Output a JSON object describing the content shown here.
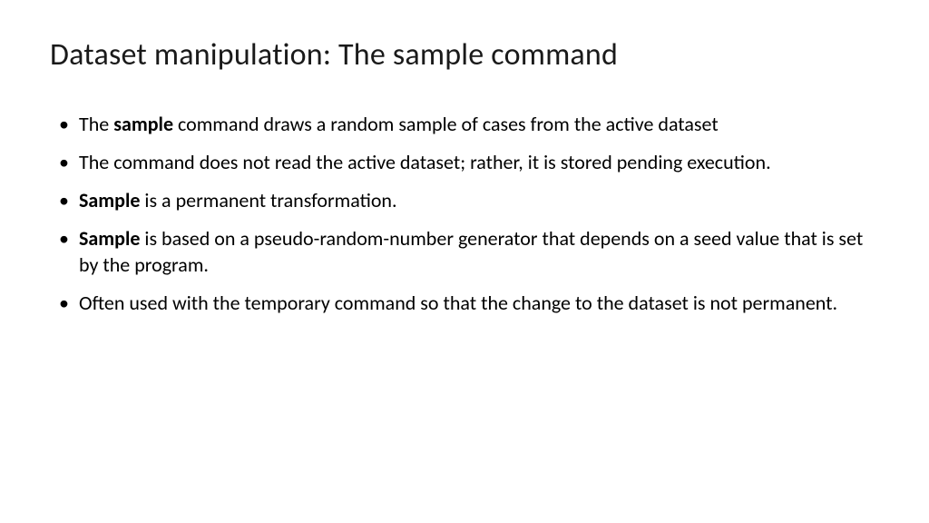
{
  "title": "Dataset manipulation: The sample command",
  "bullets": [
    {
      "pre": "The ",
      "bold": "sample",
      "post": " command draws a random sample of cases from the active dataset"
    },
    {
      "pre": "The command does not read the active dataset; rather, it is stored pending execution.",
      "bold": "",
      "post": ""
    },
    {
      "pre": "",
      "bold": "Sample",
      "post": " is a permanent transformation."
    },
    {
      "pre": "",
      "bold": "Sample",
      "post": " is based on a pseudo-random-number generator that depends on a seed value that is set by the program."
    },
    {
      "pre": "Often used with the temporary command so that the change to the dataset is not permanent.",
      "bold": "",
      "post": ""
    }
  ]
}
